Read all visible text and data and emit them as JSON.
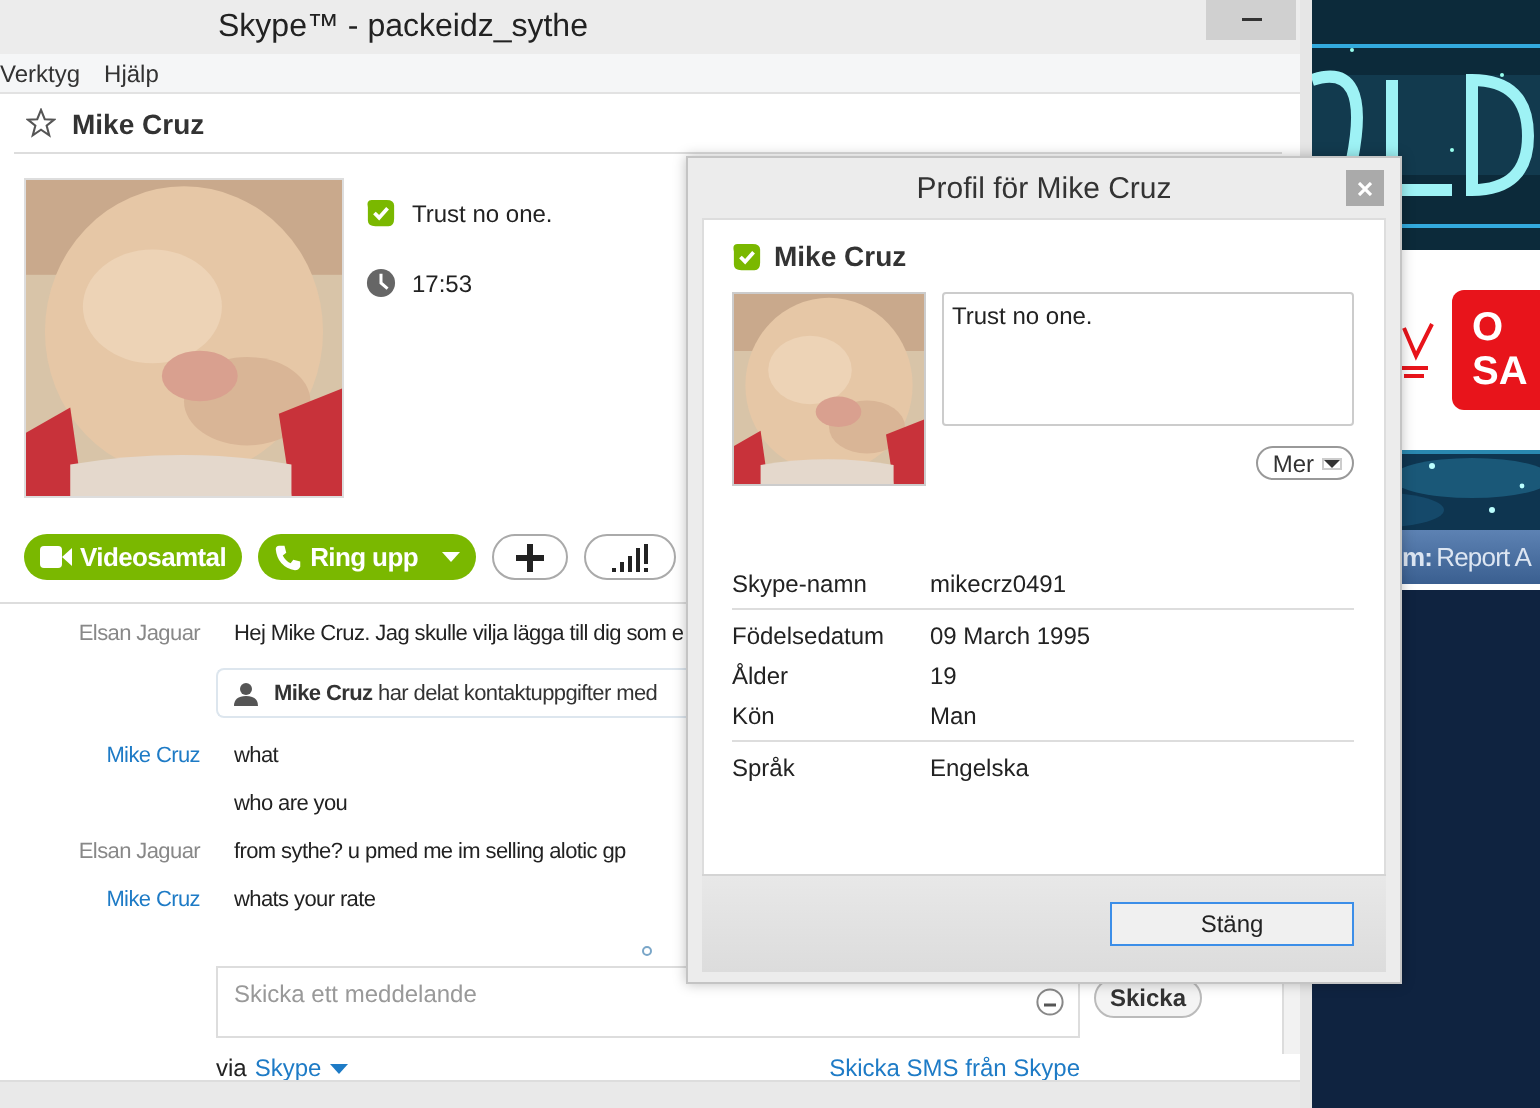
{
  "window": {
    "title": "Skype™ - packeidz_sythe",
    "menu": [
      "Verktyg",
      "Hjälp"
    ]
  },
  "contact": {
    "name": "Mike Cruz",
    "favorite": false,
    "mood": "Trust no one.",
    "local_time": "17:53"
  },
  "actions": [
    {
      "kind": "video",
      "label": "Videosamtal"
    },
    {
      "kind": "call",
      "label": "Ring upp"
    },
    {
      "kind": "add"
    },
    {
      "kind": "quality"
    }
  ],
  "messages": [
    {
      "kind": "text",
      "sender": "Elsan Jaguar",
      "from_contact": false,
      "text": "Hej Mike Cruz. Jag skulle vilja lägga till dig som e"
    },
    {
      "kind": "share",
      "text": "**Mike Cruz** har delat kontaktuppgifter med"
    },
    {
      "kind": "text",
      "sender": "Mike Cruz",
      "from_contact": true,
      "text": "what"
    },
    {
      "kind": "text",
      "text": "who are you"
    },
    {
      "kind": "text",
      "sender": "Elsan Jaguar",
      "from_contact": false,
      "text": "from sythe? u pmed me im selling alotic gp"
    },
    {
      "kind": "text",
      "sender": "Mike Cruz",
      "from_contact": true,
      "text": "whats your rate"
    }
  ],
  "composer": {
    "placeholder": "Skicka ett meddelande",
    "send": "Skicka",
    "via_label": "via",
    "via_service": "Skype",
    "sms_link": "Skicka SMS från Skype"
  },
  "profile_dialog": {
    "title": "Profil för Mike Cruz",
    "name": "Mike Cruz",
    "mood": "Trust no one.",
    "more": "Mer",
    "groups": [
      [
        {
          "label": "Skype-namn",
          "value": "mikecrz0491"
        }
      ],
      [
        {
          "label": "Födelsedatum",
          "value": "09 March 1995"
        },
        {
          "label": "Ålder",
          "value": "19"
        },
        {
          "label": "Kön",
          "value": "Man"
        }
      ],
      [
        {
          "label": "Språk",
          "value": "Engelska"
        }
      ]
    ],
    "close": "Stäng"
  },
  "background_page": {
    "button_lines": [
      "O",
      "SA"
    ],
    "nav_label": "m:",
    "nav_link": "Report A"
  }
}
